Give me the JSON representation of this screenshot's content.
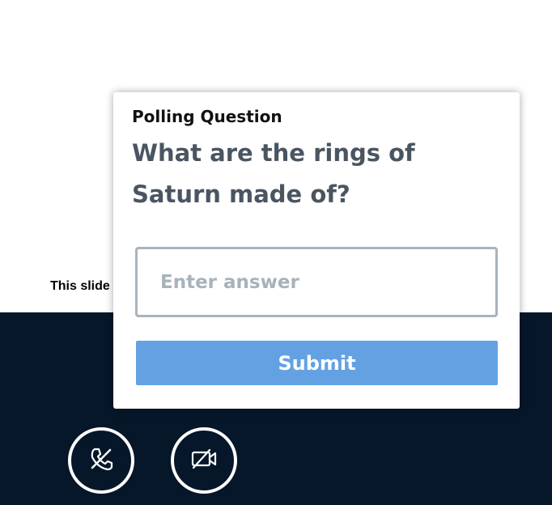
{
  "slide": {
    "caption": "This slide"
  },
  "poll": {
    "label": "Polling Question",
    "question": "What are the rings of Saturn made of?",
    "answer_placeholder": "Enter answer",
    "answer_value": "",
    "submit_label": "Submit"
  },
  "controls": [
    {
      "name": "audio",
      "icon": "phone-hangup-icon"
    },
    {
      "name": "video",
      "icon": "video-off-icon"
    }
  ],
  "colors": {
    "bar_background": "#06172a",
    "submit_button": "#63a1e3",
    "question_text": "#4a5562"
  }
}
